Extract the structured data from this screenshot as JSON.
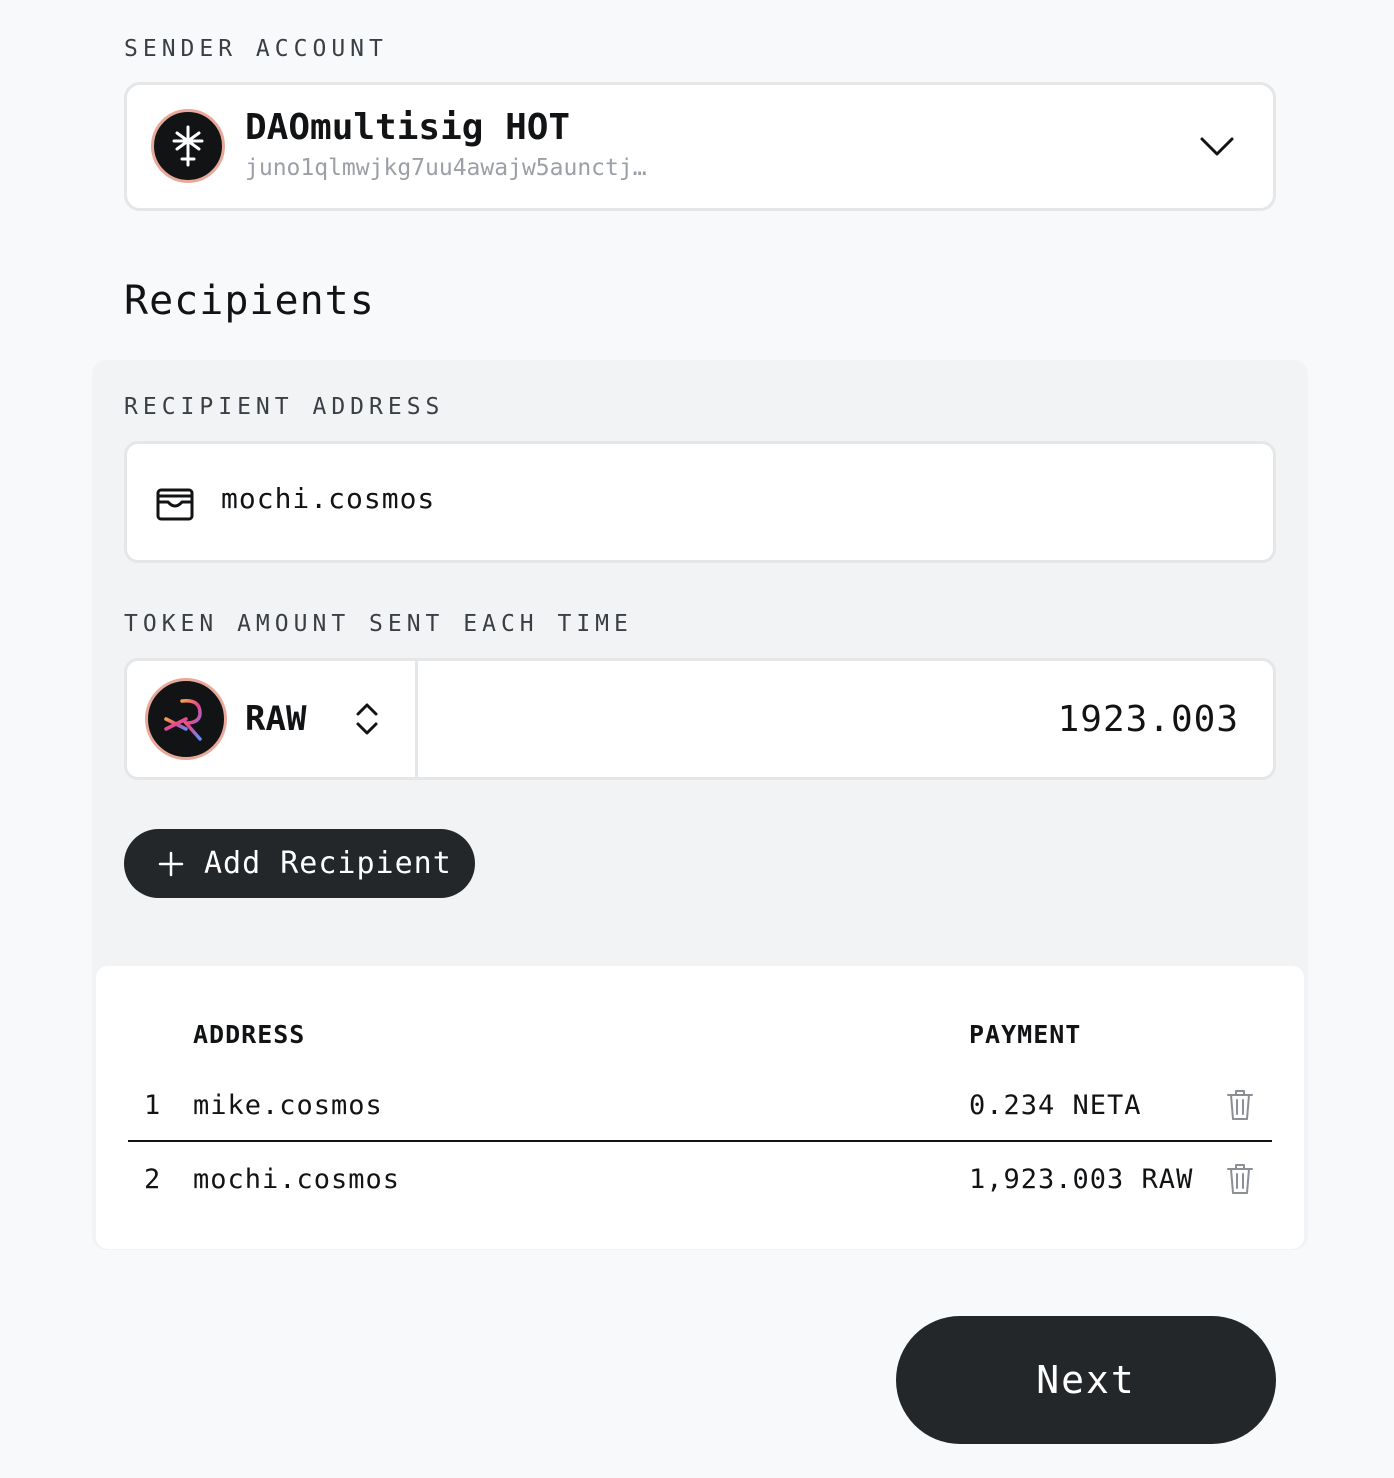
{
  "sender": {
    "label": "SENDER ACCOUNT",
    "name": "DAOmultisig HOT",
    "address": "juno1qlmwjkg7uu4awajw5aunctj…"
  },
  "recipients": {
    "heading": "Recipients",
    "address_label": "RECIPIENT ADDRESS",
    "address_value": "mochi.cosmos",
    "amount_label": "TOKEN AMOUNT SENT EACH TIME",
    "token_symbol": "RAW",
    "amount_value": "1923.003",
    "add_button": "Add Recipient"
  },
  "table": {
    "headers": {
      "address": "ADDRESS",
      "payment": "PAYMENT"
    },
    "rows": [
      {
        "index": "1",
        "address": "mike.cosmos",
        "payment": "0.234 NETA"
      },
      {
        "index": "2",
        "address": "mochi.cosmos",
        "payment": "1,923.003 RAW"
      }
    ]
  },
  "next_button": "Next",
  "colors": {
    "background": "#f8f9fa",
    "panel": "#f2f3f5",
    "button_dark": "#23272a",
    "avatar_ring": "#e8a99a",
    "muted_text": "#9aa0a6"
  },
  "icons": {
    "sender_avatar": "juno-star-icon",
    "chevron": "chevron-down-icon",
    "wallet": "wallet-icon",
    "token_avatar": "raw-token-icon",
    "selector": "chevron-up-down-icon",
    "add": "plus-icon",
    "delete": "trash-icon"
  }
}
